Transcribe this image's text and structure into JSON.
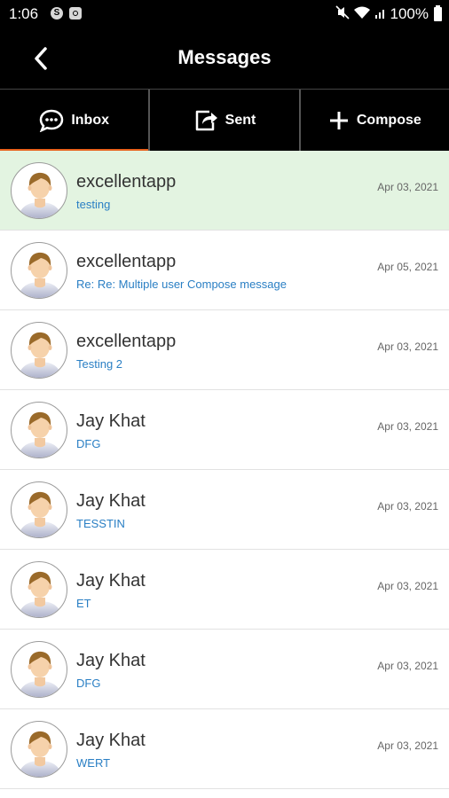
{
  "status_bar": {
    "time": "1:06",
    "battery": "100%"
  },
  "header": {
    "title": "Messages"
  },
  "tabs": [
    {
      "label": "Inbox",
      "icon": "chat-bubble-icon",
      "active": true
    },
    {
      "label": "Sent",
      "icon": "share-icon",
      "active": false
    },
    {
      "label": "Compose",
      "icon": "plus-icon",
      "active": false
    }
  ],
  "colors": {
    "active_tab_underline": "#e8621c",
    "selected_row": "#e3f4e1",
    "subject_text": "#2a7fc4"
  },
  "messages": [
    {
      "sender": "excellentapp",
      "subject": "testing",
      "date": "Apr 03, 2021",
      "selected": true
    },
    {
      "sender": "excellentapp",
      "subject": "Re: Re: Multiple user Compose message",
      "date": "Apr 05, 2021",
      "selected": false
    },
    {
      "sender": "excellentapp",
      "subject": "Testing 2",
      "date": "Apr 03, 2021",
      "selected": false
    },
    {
      "sender": "Jay Khat",
      "subject": "DFG",
      "date": "Apr 03, 2021",
      "selected": false
    },
    {
      "sender": "Jay Khat",
      "subject": "TESSTIN",
      "date": "Apr 03, 2021",
      "selected": false
    },
    {
      "sender": "Jay Khat",
      "subject": "ET",
      "date": "Apr 03, 2021",
      "selected": false
    },
    {
      "sender": "Jay Khat",
      "subject": "DFG",
      "date": "Apr 03, 2021",
      "selected": false
    },
    {
      "sender": "Jay Khat",
      "subject": "WERT",
      "date": "Apr 03, 2021",
      "selected": false
    }
  ]
}
